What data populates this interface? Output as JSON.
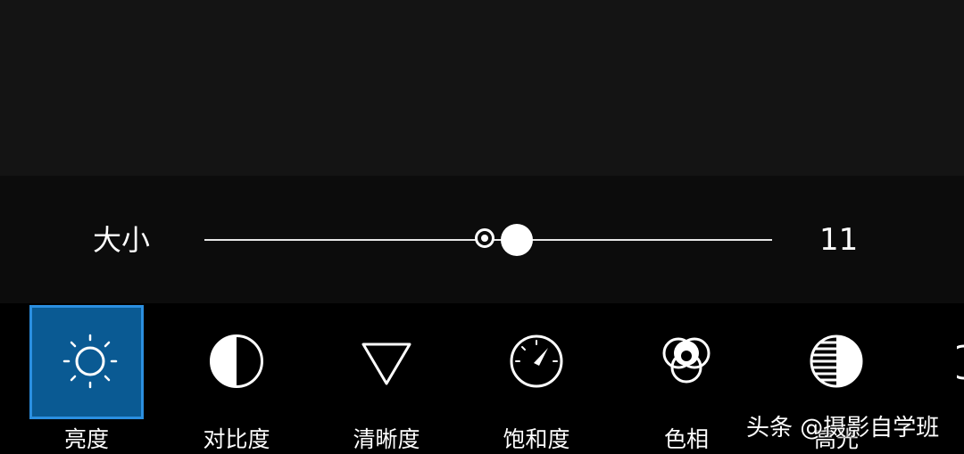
{
  "slider": {
    "label": "大小",
    "value": "11",
    "level_fraction": 0.55
  },
  "tools": [
    {
      "label": "亮度",
      "icon": "brightness-sun-icon",
      "selected": true
    },
    {
      "label": "对比度",
      "icon": "contrast-half-circle-icon",
      "selected": false
    },
    {
      "label": "清晰度",
      "icon": "clarity-triangle-icon",
      "selected": false
    },
    {
      "label": "饱和度",
      "icon": "saturation-gauge-icon",
      "selected": false
    },
    {
      "label": "色相",
      "icon": "hue-circles-icon",
      "selected": false
    },
    {
      "label": "高光",
      "icon": "highlights-striped-circle-icon",
      "selected": false
    }
  ],
  "watermark": {
    "text": "头条 @摄影自学班"
  },
  "colors": {
    "selected_bg": "#0a5a93",
    "selected_border": "#2b8fe0",
    "panel": "#0c0c0c",
    "preview": "#141414"
  }
}
